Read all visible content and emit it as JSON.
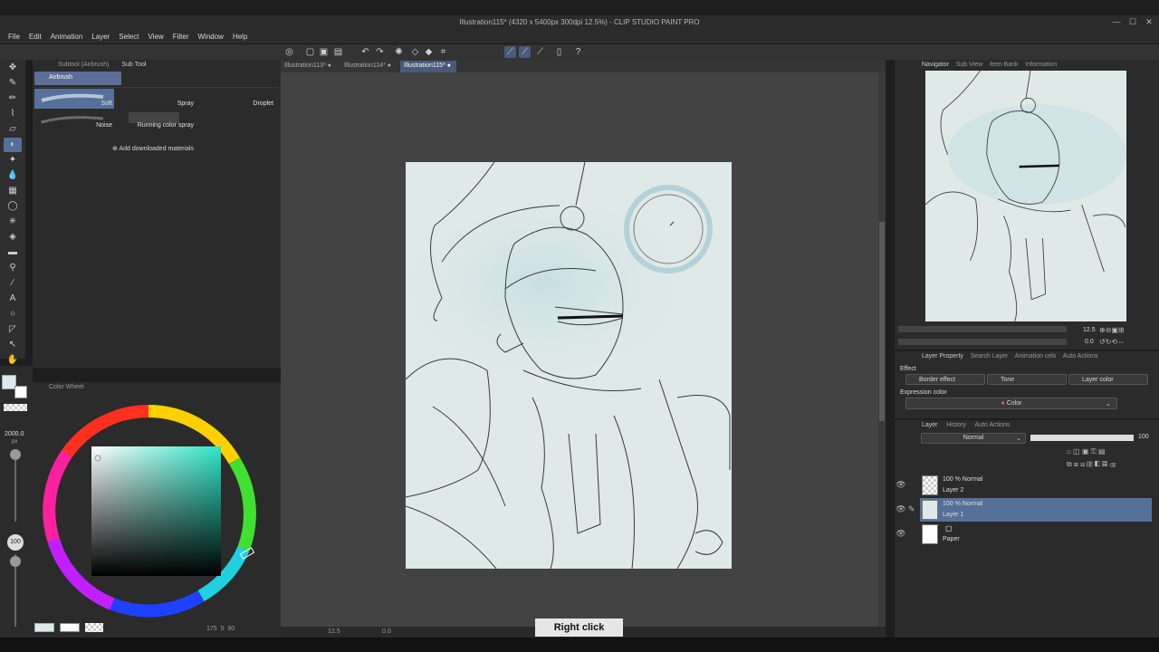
{
  "window": {
    "title": "Illustration115* (4320 x 5400px 300dpi 12.5%) - CLIP STUDIO PAINT PRO"
  },
  "menu": [
    "File",
    "Edit",
    "Animation",
    "Layer",
    "Select",
    "View",
    "Filter",
    "Window",
    "Help"
  ],
  "subtool": {
    "tabs": [
      "Subtool (Airbrush)",
      "Sub Tool"
    ],
    "group": "Airbrush",
    "brushes": [
      "Soft",
      "Spray",
      "Droplet",
      "Noise",
      "Running color spray"
    ],
    "add_materials": "Add downloaded materials"
  },
  "color": {
    "panel_tab": "Color Wheel",
    "brush_size": "2000.0",
    "brush_size_unit": "px",
    "opacity": "100",
    "main_color": "#dfe9e8",
    "sub_color": "#ffffff"
  },
  "document_tabs": [
    "Illustration113*",
    "Illustration114*",
    "Illustration115*"
  ],
  "status": {
    "zoom": "12.5",
    "angle": "0.0",
    "memory": "175",
    "layer_count": "5",
    "fps": "90"
  },
  "caption": "Right click",
  "navigator": {
    "tabs": [
      "Navigator",
      "Sub View",
      "Item Bank",
      "Information"
    ],
    "zoom": "12.5",
    "rotation": "0.0"
  },
  "layer_property": {
    "tabs": [
      "Layer Property",
      "Search Layer",
      "Animation cels",
      "Auto Actions"
    ],
    "section": "Effect",
    "effects": [
      "Border effect",
      "Tone",
      "Layer color"
    ],
    "expression_label": "Expression color",
    "expression_value": "Color"
  },
  "layers": {
    "tabs": [
      "Layer",
      "History",
      "Auto Actions"
    ],
    "blend_mode": "Normal",
    "opacity": "100",
    "items": [
      {
        "mode": "100 % Normal",
        "name": "Layer 2"
      },
      {
        "mode": "100 % Normal",
        "name": "Layer 1"
      },
      {
        "mode": "",
        "name": "Paper"
      }
    ]
  }
}
